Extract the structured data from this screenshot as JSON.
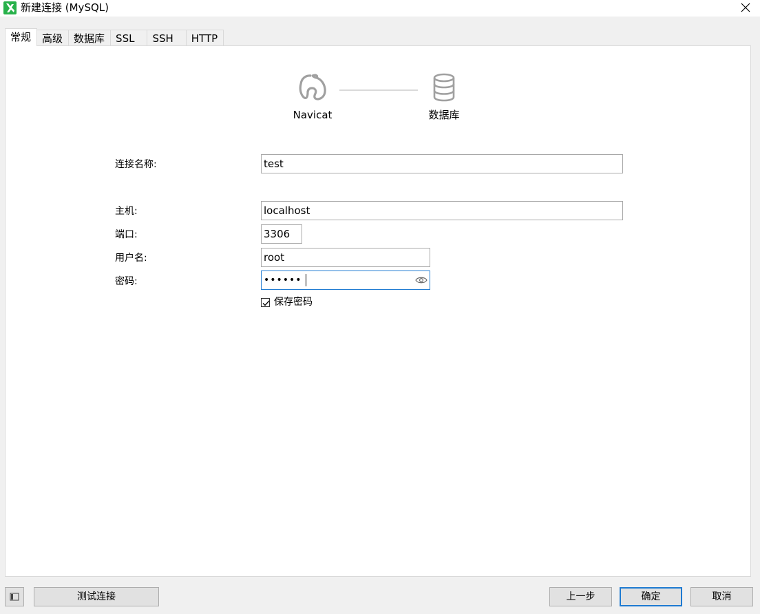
{
  "window": {
    "title": "新建连接 (MySQL)"
  },
  "tabs": [
    {
      "label": "常规",
      "active": true
    },
    {
      "label": "高级",
      "active": false
    },
    {
      "label": "数据库",
      "active": false
    },
    {
      "label": "SSL",
      "active": false
    },
    {
      "label": "SSH",
      "active": false
    },
    {
      "label": "HTTP",
      "active": false
    }
  ],
  "header": {
    "left_label": "Navicat",
    "right_label": "数据库",
    "left_icon": "navicat-logo-icon",
    "right_icon": "database-icon"
  },
  "form": {
    "connection_name": {
      "label": "连接名称:",
      "value": "test"
    },
    "host": {
      "label": "主机:",
      "value": "localhost"
    },
    "port": {
      "label": "端口:",
      "value": "3306"
    },
    "username": {
      "label": "用户名:",
      "value": "root"
    },
    "password": {
      "label": "密码:",
      "value": "••••••"
    },
    "save_password": {
      "label": "保存密码",
      "checked": true
    }
  },
  "buttons": {
    "test_connection": "测试连接",
    "previous": "上一步",
    "ok": "确定",
    "cancel": "取消"
  },
  "colors": {
    "accent": "#1e7ad1",
    "app_icon": "#27b14a"
  }
}
